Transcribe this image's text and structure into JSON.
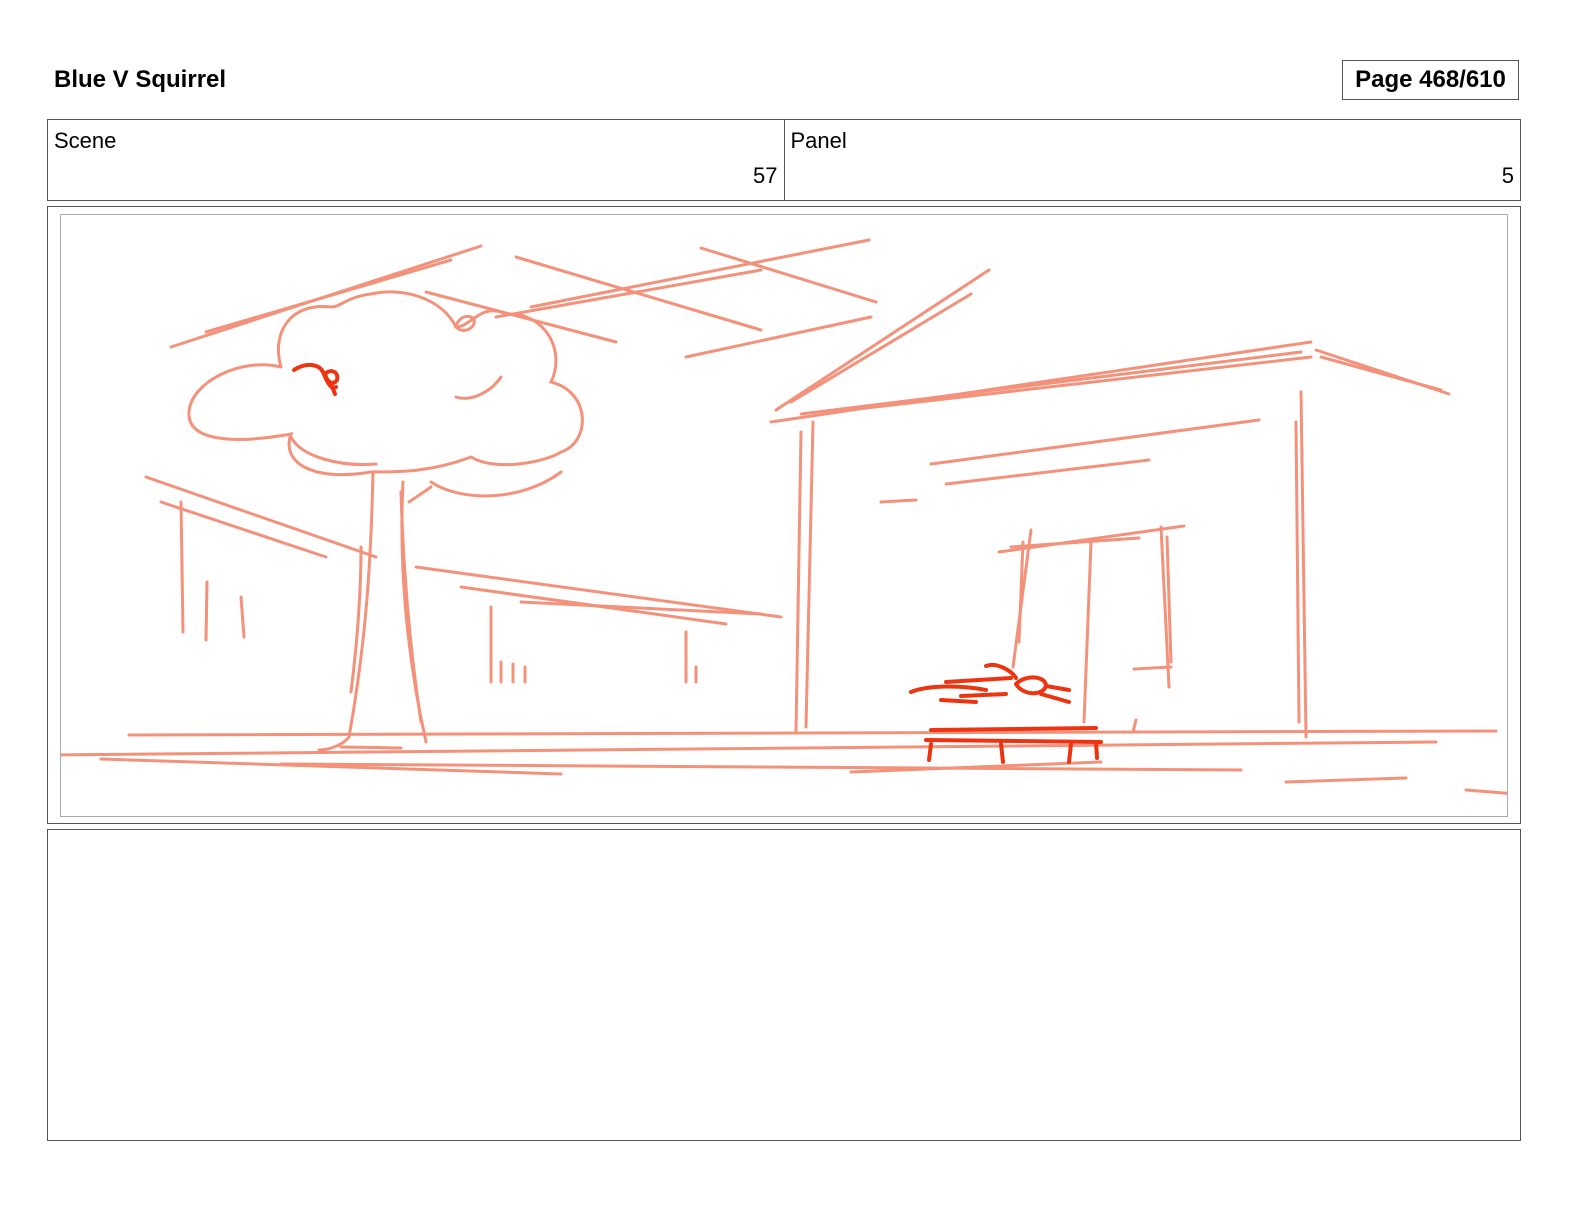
{
  "header": {
    "title": "Blue V Squirrel",
    "page_label": "Page 468/610"
  },
  "info": {
    "scene_label": "Scene",
    "scene_value": "57",
    "panel_label": "Panel",
    "panel_value": "5"
  },
  "sketch": {
    "stroke_color": "#f4917a",
    "accent_color": "#ee3311"
  },
  "notes": {
    "text": ""
  }
}
